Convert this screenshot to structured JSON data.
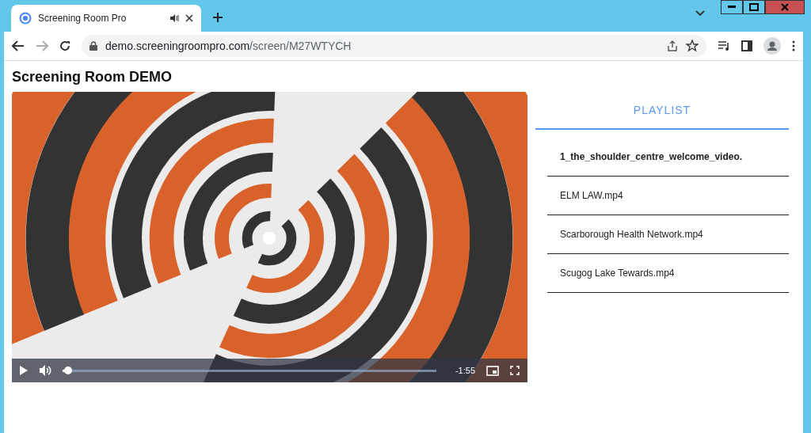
{
  "browser": {
    "tab": {
      "title": "Screening Room Pro",
      "selected": true
    },
    "address": {
      "domain": "demo.screeningroompro.com",
      "path": "/screen/M27WTYCH"
    }
  },
  "page": {
    "title": "Screening Room DEMO"
  },
  "player": {
    "progress": {
      "level": 0.015
    },
    "time_remaining": "-1:55"
  },
  "playlist": {
    "tab": {
      "label": "PLAYLIST",
      "selected": true
    },
    "items": [
      {
        "label": "1_the_shoulder_centre_welcome_video.",
        "selected": true
      },
      {
        "label": "ELM LAW.mp4",
        "selected": false
      },
      {
        "label": "Scarborough Health Network.mp4",
        "selected": false
      },
      {
        "label": "Scugog Lake Tewards.mp4",
        "selected": false
      }
    ]
  }
}
